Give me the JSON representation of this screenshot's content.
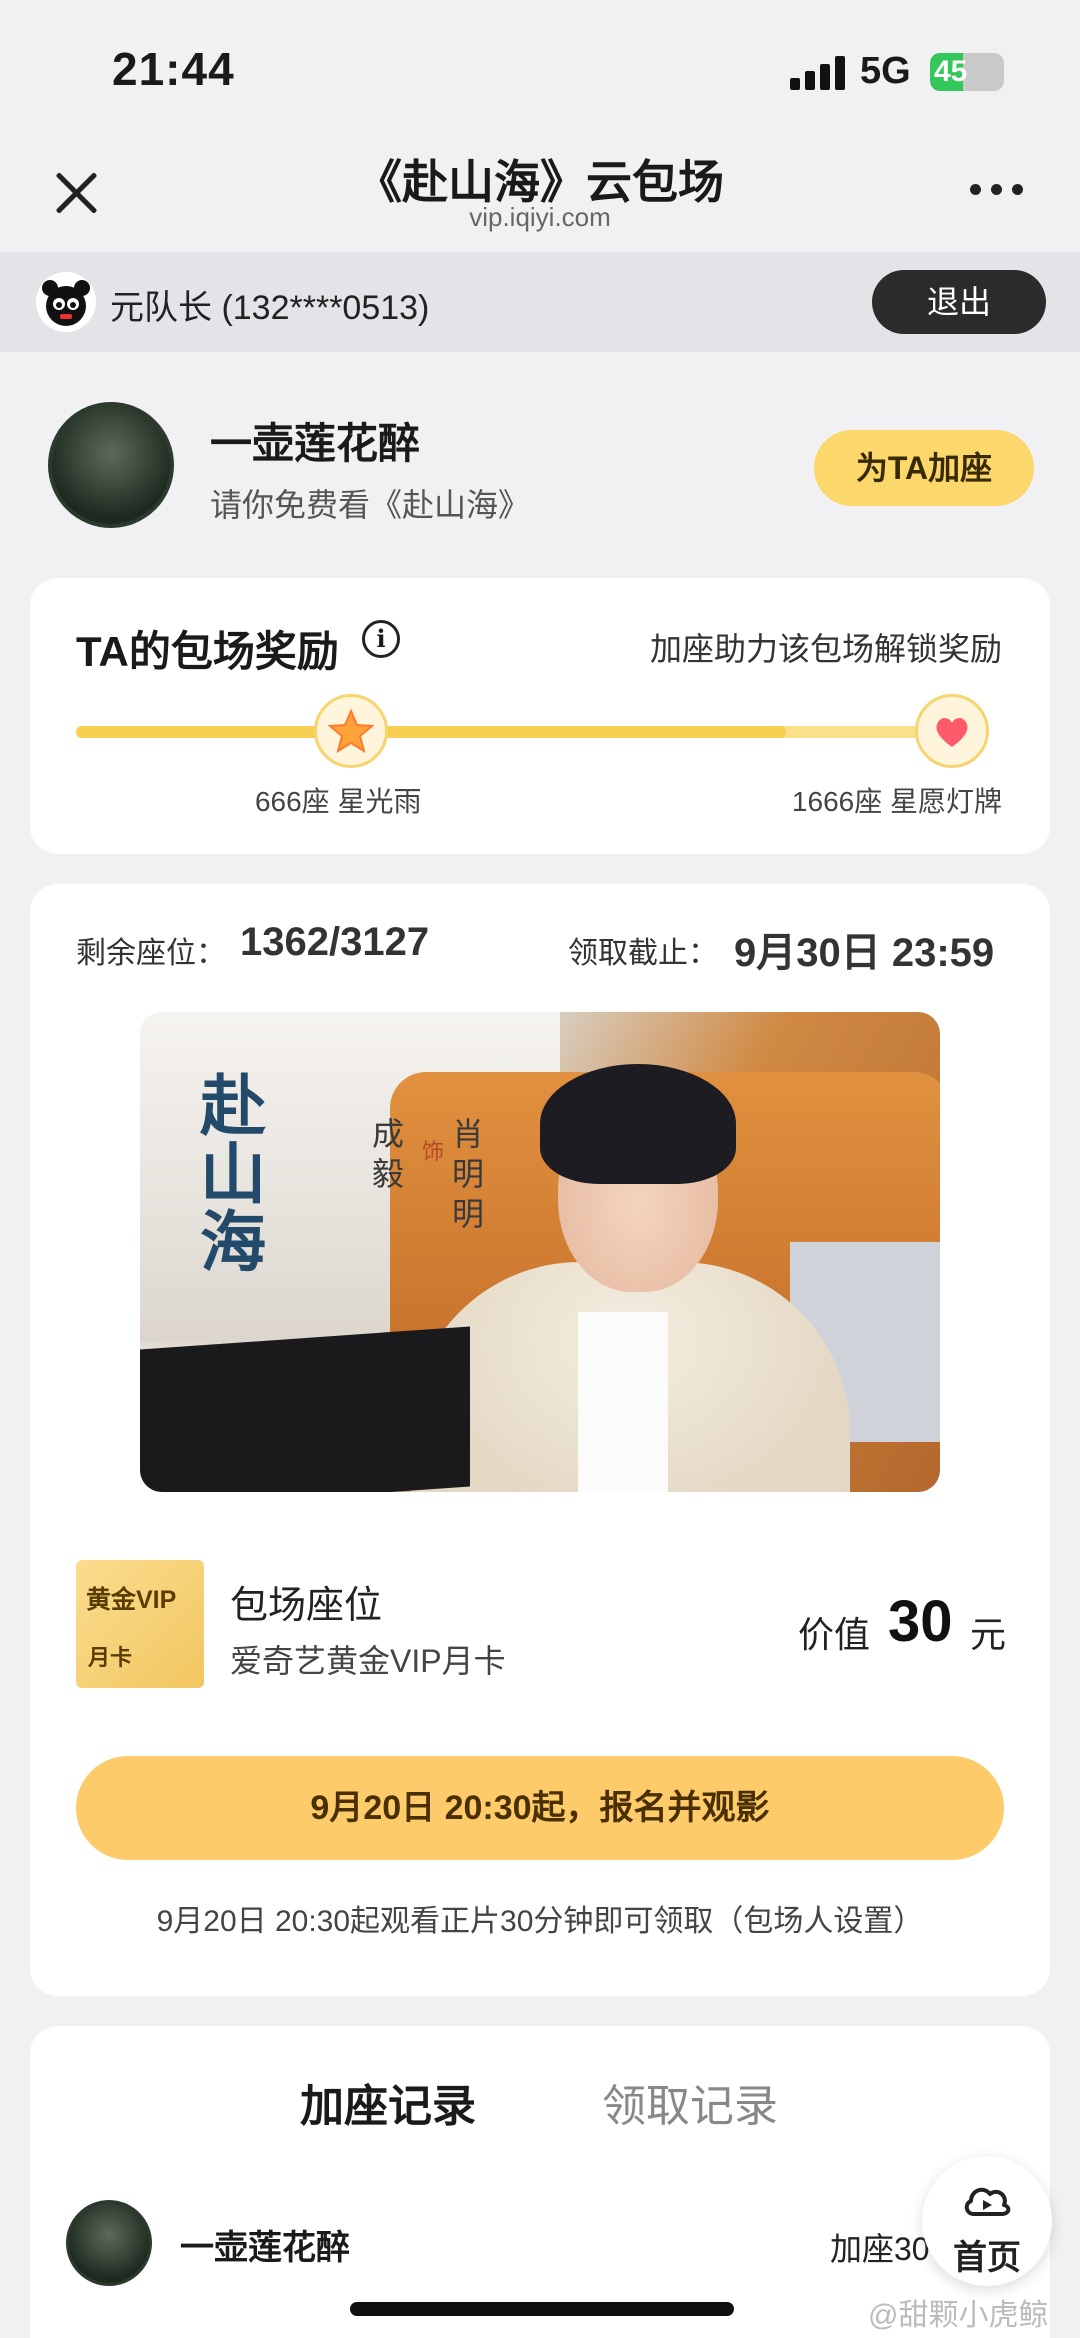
{
  "status_bar": {
    "time": "21:44",
    "network": "5G",
    "battery": "45",
    "battery_level": 0.45
  },
  "nav": {
    "title": "《赴山海》云包场",
    "subtitle": "vip.iqiyi.com"
  },
  "user": {
    "name": "元队长 (132****0513)",
    "logout_label": "退出"
  },
  "host": {
    "name": "一壶莲花醉",
    "invite": "请你免费看《赴山海》",
    "add_seat_label": "为TA加座"
  },
  "reward": {
    "title": "TA的包场奖励",
    "hint": "加座助力该包场解锁奖励",
    "progress": 0.8,
    "milestones": [
      {
        "label": "666座 星光雨",
        "icon": "star-icon",
        "position": 0.4
      },
      {
        "label": "1666座 星愿灯牌",
        "icon": "heart-hand-icon",
        "position": 1.0
      }
    ]
  },
  "session": {
    "seats_label": "剩余座位：",
    "seats_value": "1362/3127",
    "deadline_label": "领取截止：",
    "deadline_value": "9月30日 23:59"
  },
  "poster": {
    "calligraphy": "赴山海",
    "role_actor": "成毅",
    "role_joiner": "饰",
    "role_character": "肖明明"
  },
  "prize": {
    "badge_line1": "黄金VIP",
    "badge_line2": "月卡",
    "title": "包场座位",
    "desc": "爱奇艺黄金VIP月卡",
    "value_label": "价值",
    "value": "30",
    "unit": "元"
  },
  "cta": {
    "button_label": "9月20日 20:30起，报名并观影",
    "note": "9月20日 20:30起观看正片30分钟即可领取（包场人设置）"
  },
  "records": {
    "tabs": [
      "加座记录",
      "领取记录"
    ],
    "rows": [
      {
        "name": "一壶莲花醉",
        "value": "加座30"
      }
    ]
  },
  "home_fab": {
    "label": "首页",
    "icon": "cloud-play-icon"
  },
  "watermark": "@甜颗小虎鲸"
}
